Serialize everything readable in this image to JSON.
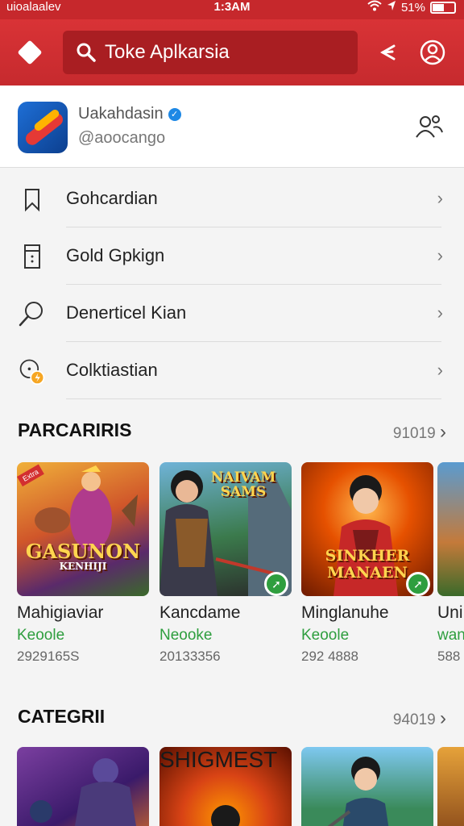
{
  "status_bar": {
    "carrier": "uioalaalev",
    "time": "1:3AM",
    "battery": "51%"
  },
  "app_bar": {
    "search_text": "Toke Aplkarsia"
  },
  "account": {
    "name": "Uakahdasin",
    "handle": "@aoocango"
  },
  "menu": [
    {
      "label": "Gohcardian",
      "icon": "bookmark-icon"
    },
    {
      "label": "Gold Gpkign",
      "icon": "document-icon"
    },
    {
      "label": "Denerticel Kian",
      "icon": "search-icon"
    },
    {
      "label": "Colktiastian",
      "icon": "collection-icon"
    }
  ],
  "section1": {
    "title": "PARCARIRIS",
    "count": "91019",
    "cards": [
      {
        "name": "Mahigiaviar",
        "developer": "Keoole",
        "number": "2929165S",
        "art_text": "GASUNON",
        "art_sub": "KENHIJI",
        "tag": "Extra"
      },
      {
        "name": "Kancdame",
        "developer": "Neooke",
        "number": "20133356",
        "art_text": "NAIVAM SAMS",
        "art_sub": ""
      },
      {
        "name": "Minglanuhe",
        "developer": "Keoole",
        "number": "292 4888",
        "art_text": "SINKHER MANAEN",
        "art_sub": ""
      },
      {
        "name": "Uni",
        "developer": "wan",
        "number": "588"
      }
    ]
  },
  "section2": {
    "title": "CATEGRII",
    "count": "94019",
    "art_text": "SHIGMEST"
  },
  "colors": {
    "brand": "#c6282c",
    "accent_green": "#2e9e3e"
  }
}
